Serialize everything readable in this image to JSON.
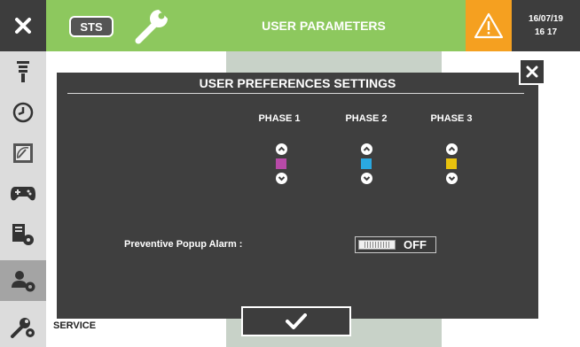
{
  "header": {
    "close_icon": "close-icon",
    "sts_label": "STS",
    "tool_icon": "wrench-icon",
    "title": "USER PARAMETERS",
    "warning_icon": "warning-icon",
    "date": "16/07/19",
    "time": "16 17",
    "colors": {
      "bar": "#8dc85e",
      "warning": "#f5a020",
      "dark": "#3d3d3d"
    }
  },
  "sidebar": {
    "items": [
      {
        "icon": "light-tower-icon"
      },
      {
        "icon": "history-clock-icon"
      },
      {
        "icon": "gauge-icon"
      },
      {
        "icon": "gamepad-icon"
      },
      {
        "icon": "machine-settings-icon"
      },
      {
        "icon": "user-settings-icon",
        "active": true
      },
      {
        "icon": "service-wrench-icon"
      }
    ],
    "service_label": "SERVICE"
  },
  "modal": {
    "title": "USER PREFERENCES SETTINGS",
    "close_icon": "close-icon",
    "phases": [
      {
        "label": "PHASE 1",
        "color": "#b84aa8"
      },
      {
        "label": "PHASE 2",
        "color": "#2aa8e0"
      },
      {
        "label": "PHASE 3",
        "color": "#e8c20e"
      }
    ],
    "popup_alarm_label": "Preventive Popup Alarm :",
    "popup_alarm_state": "OFF",
    "confirm_icon": "check-icon"
  }
}
